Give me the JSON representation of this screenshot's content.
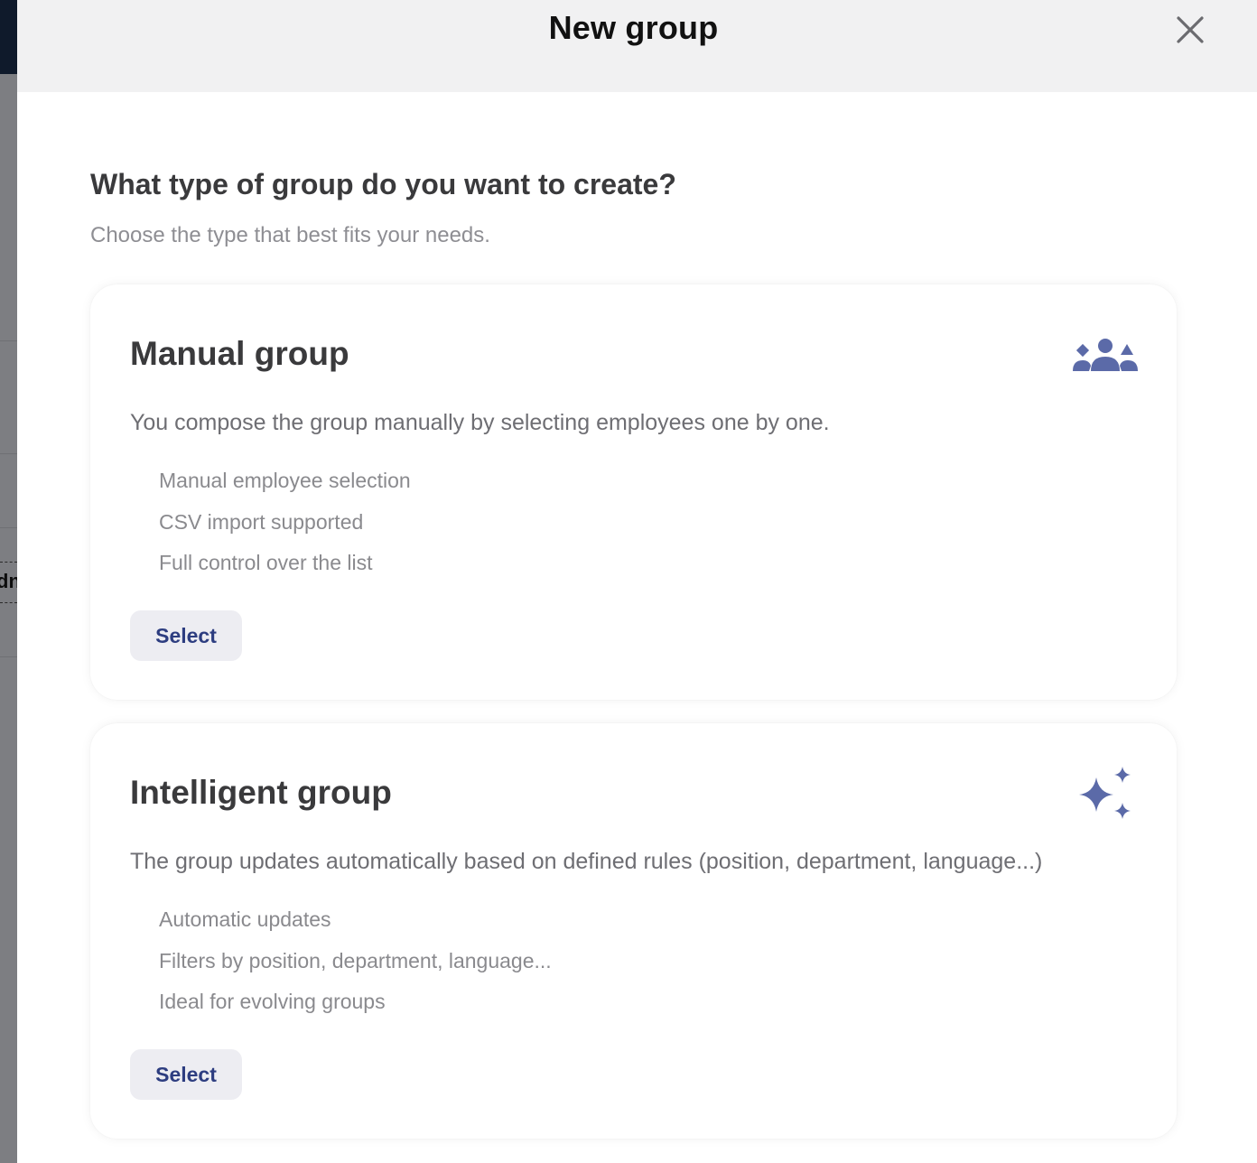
{
  "background": {
    "partial_text": "dn"
  },
  "modal": {
    "title": "New group",
    "close_icon": "close-icon"
  },
  "intro": {
    "question": "What type of group do you want to create?",
    "subtitle": "Choose the type that best fits your needs."
  },
  "options": [
    {
      "title": "Manual group",
      "icon": "people-group-icon",
      "description": "You compose the group manually by selecting employees one by one.",
      "features": [
        "Manual employee selection",
        "CSV import supported",
        "Full control over the list"
      ],
      "button_label": "Select"
    },
    {
      "title": "Intelligent group",
      "icon": "sparkles-icon",
      "description": "The group updates automatically based on defined rules (position, department, language...)",
      "features": [
        "Automatic updates",
        "Filters by position, department, language...",
        "Ideal for evolving groups"
      ],
      "button_label": "Select"
    }
  ],
  "colors": {
    "accent": "#2d3d80",
    "icon": "#5b6aa8",
    "header_bg": "#f1f1f2",
    "button_bg": "#ededf2"
  }
}
